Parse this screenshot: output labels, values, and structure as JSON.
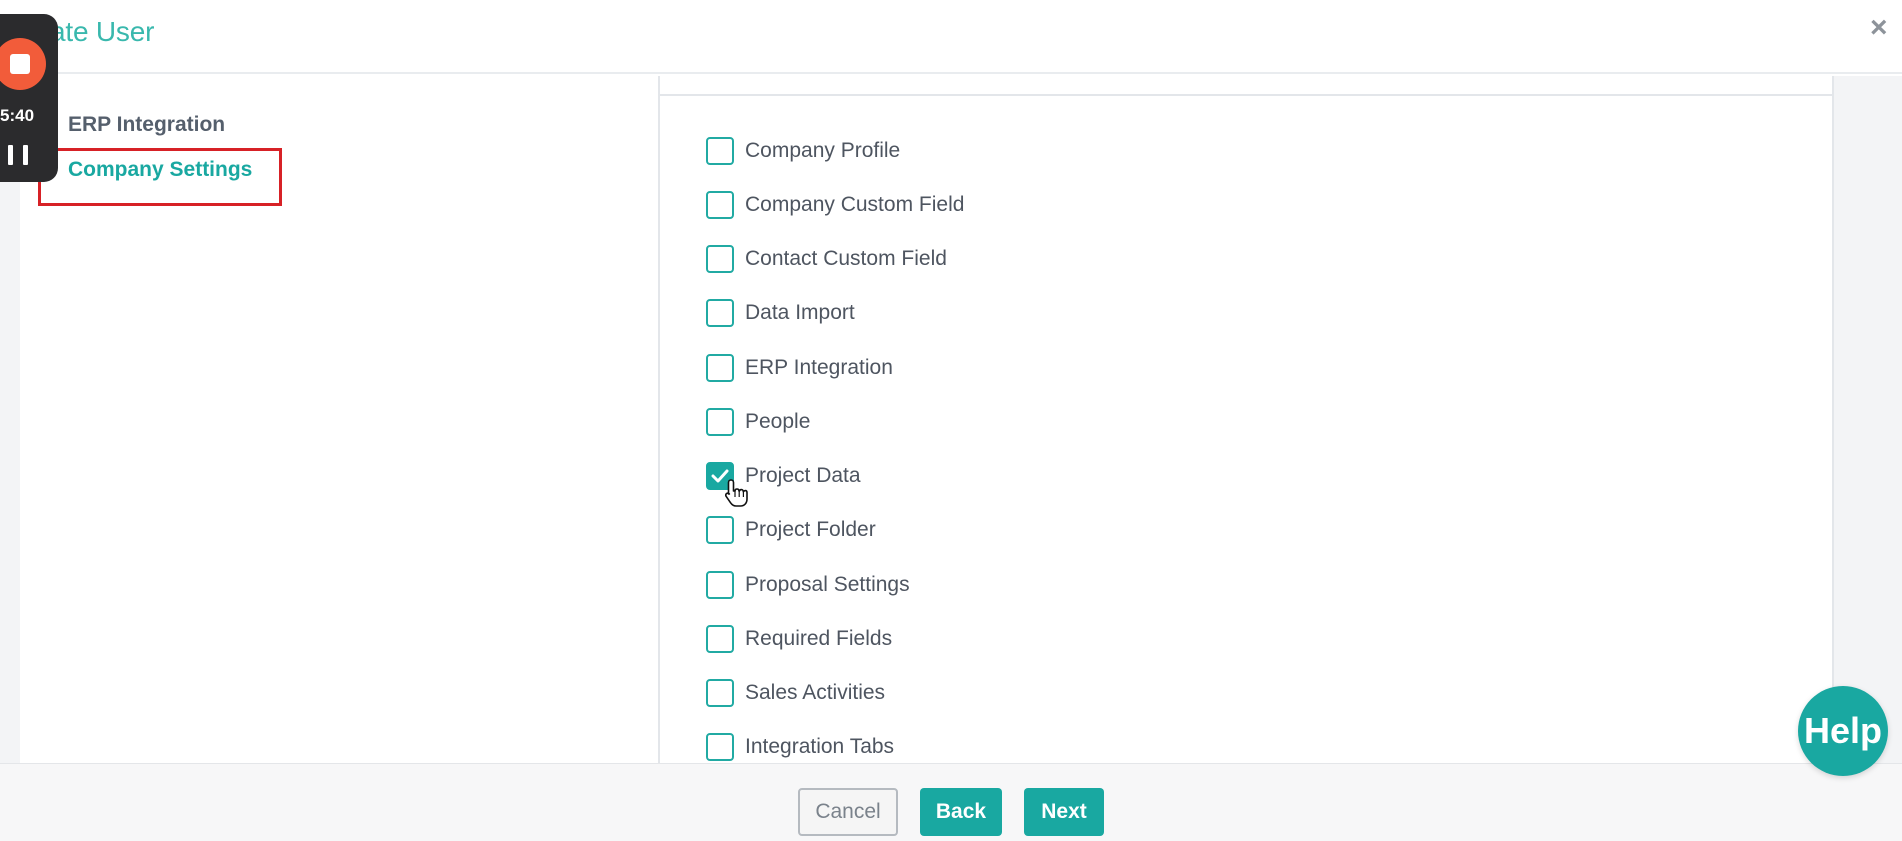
{
  "header": {
    "title": "ate User",
    "close_icon": "×"
  },
  "recorder": {
    "time": "5:40"
  },
  "sidebar": {
    "items": [
      {
        "label": "ERP Integration",
        "active": false
      },
      {
        "label": "Company Settings",
        "active": true
      }
    ]
  },
  "permissions": {
    "items": [
      {
        "label": "Company Profile",
        "checked": false
      },
      {
        "label": "Company Custom Field",
        "checked": false
      },
      {
        "label": "Contact Custom Field",
        "checked": false
      },
      {
        "label": "Data Import",
        "checked": false
      },
      {
        "label": "ERP Integration",
        "checked": false
      },
      {
        "label": "People",
        "checked": false
      },
      {
        "label": "Project Data",
        "checked": true
      },
      {
        "label": "Project Folder",
        "checked": false
      },
      {
        "label": "Proposal Settings",
        "checked": false
      },
      {
        "label": "Required Fields",
        "checked": false
      },
      {
        "label": "Sales Activities",
        "checked": false
      },
      {
        "label": "Integration Tabs",
        "checked": false
      }
    ]
  },
  "footer": {
    "cancel_label": "Cancel",
    "back_label": "Back",
    "next_label": "Next"
  },
  "help": {
    "label": "Help"
  },
  "colors": {
    "accent": "#19a8a1",
    "highlight_border": "#d72126",
    "record_button": "#f25c3a"
  }
}
